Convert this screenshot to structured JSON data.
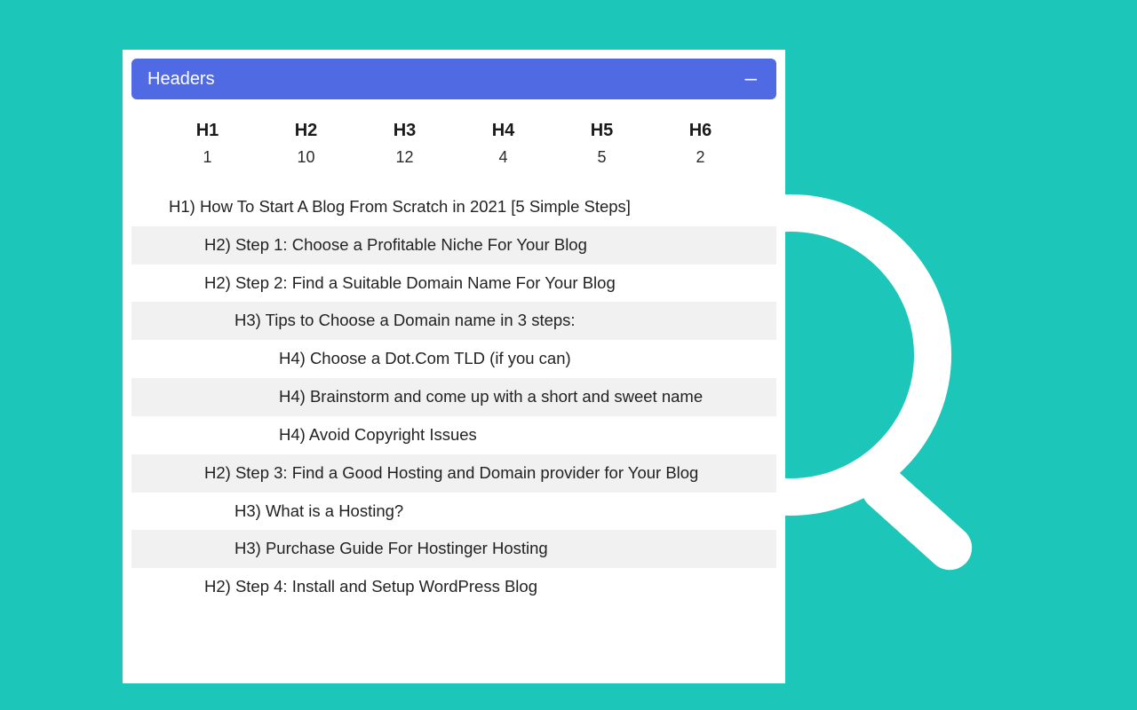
{
  "panel": {
    "title": "Headers",
    "collapse_glyph": "–"
  },
  "counts": [
    {
      "label": "H1",
      "value": "1"
    },
    {
      "label": "H2",
      "value": "10"
    },
    {
      "label": "H3",
      "value": "12"
    },
    {
      "label": "H4",
      "value": "4"
    },
    {
      "label": "H5",
      "value": "5"
    },
    {
      "label": "H6",
      "value": "2"
    }
  ],
  "headers": [
    {
      "level": 1,
      "text": "H1) How To Start A Blog From Scratch in 2021 [5 Simple Steps]"
    },
    {
      "level": 2,
      "text": "H2) Step 1: Choose a Profitable Niche For Your Blog"
    },
    {
      "level": 2,
      "text": "H2) Step 2: Find a Suitable Domain Name For Your Blog"
    },
    {
      "level": 3,
      "text": "H3) Tips to Choose a Domain name in 3 steps:"
    },
    {
      "level": 4,
      "text": "H4) Choose a Dot.Com TLD (if you can)"
    },
    {
      "level": 4,
      "text": "H4) Brainstorm and come up with a short and sweet name"
    },
    {
      "level": 4,
      "text": "H4) Avoid Copyright Issues"
    },
    {
      "level": 2,
      "text": "H2) Step 3: Find a Good Hosting and Domain provider for Your Blog"
    },
    {
      "level": 3,
      "text": "H3) What is a Hosting?"
    },
    {
      "level": 3,
      "text": "H3) Purchase Guide For Hostinger Hosting"
    },
    {
      "level": 2,
      "text": "H2) Step 4: Install and Setup WordPress Blog"
    }
  ]
}
